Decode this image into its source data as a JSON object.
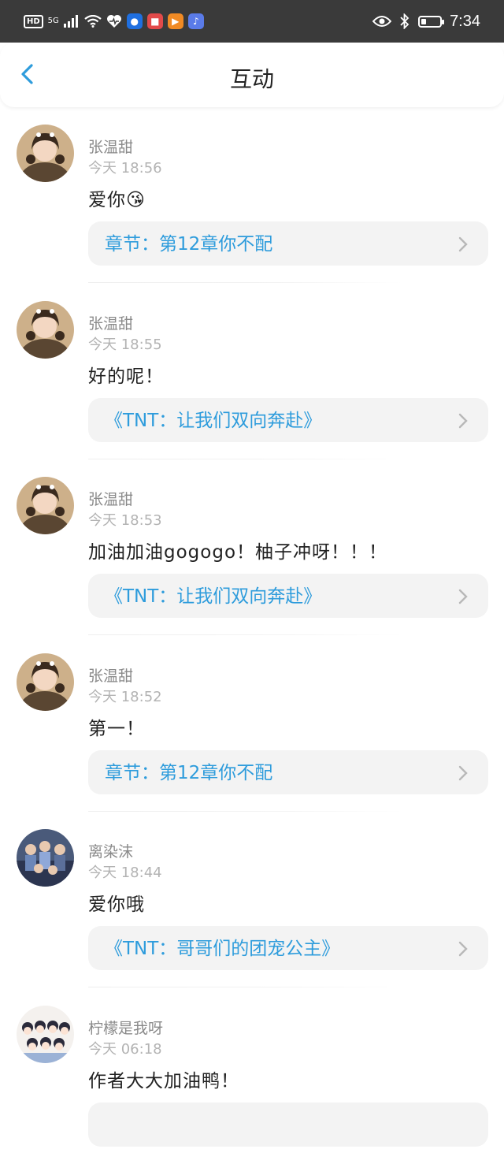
{
  "status_bar": {
    "hd": "HD",
    "signal": "5G",
    "time": "7:34"
  },
  "header": {
    "title": "互动"
  },
  "items": [
    {
      "name": "张温甜",
      "time": "今天 18:56",
      "message": "爱你😘",
      "reference": "章节：第12章你不配"
    },
    {
      "name": "张温甜",
      "time": "今天 18:55",
      "message": "好的呢！",
      "reference": "《TNT：让我们双向奔赴》"
    },
    {
      "name": "张温甜",
      "time": "今天 18:53",
      "message": "加油加油gogogo！柚子冲呀！！！",
      "reference": "《TNT：让我们双向奔赴》"
    },
    {
      "name": "张温甜",
      "time": "今天 18:52",
      "message": "第一！",
      "reference": "章节：第12章你不配"
    },
    {
      "name": "离染沫",
      "time": "今天 18:44",
      "message": "爱你哦",
      "reference": "《TNT：哥哥们的团宠公主》"
    },
    {
      "name": "柠檬是我呀",
      "time": "今天 06:18",
      "message": "作者大大加油鸭！",
      "reference": ""
    }
  ],
  "colors": {
    "accent": "#2e9cdc",
    "status_bar": "#3a3a3a"
  }
}
